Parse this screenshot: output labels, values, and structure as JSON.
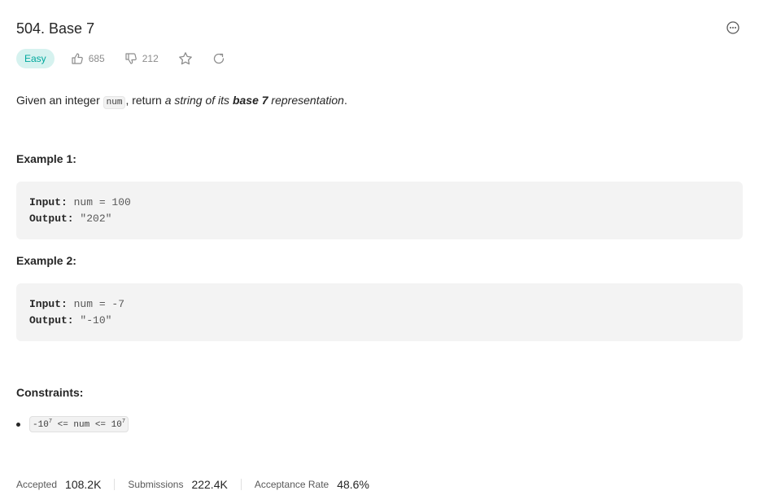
{
  "problem": {
    "title": "504. Base 7",
    "difficulty": "Easy",
    "likes": "685",
    "dislikes": "212"
  },
  "description": {
    "prefix": "Given an integer ",
    "code": "num",
    "middle": ", return ",
    "italic1": "a string of its ",
    "bold": "base 7",
    "italic2": " representation",
    "suffix": "."
  },
  "examples": [
    {
      "title": "Example 1:",
      "input_label": "Input:",
      "input_value": " num = 100",
      "output_label": "Output:",
      "output_value": " \"202\""
    },
    {
      "title": "Example 2:",
      "input_label": "Input:",
      "input_value": " num = -7",
      "output_label": "Output:",
      "output_value": " \"-10\""
    }
  ],
  "constraints": {
    "title": "Constraints:",
    "item_pre": "-10",
    "exp1": "7",
    "item_mid": " <= num <= 10",
    "exp2": "7"
  },
  "stats": {
    "accepted_label": "Accepted",
    "accepted_value": "108.2K",
    "submissions_label": "Submissions",
    "submissions_value": "222.4K",
    "rate_label": "Acceptance Rate",
    "rate_value": "48.6%"
  },
  "icons": {
    "like": "thumbs-up-icon",
    "dislike": "thumbs-down-icon",
    "star": "star-icon",
    "share": "share-icon",
    "more": "more-icon"
  },
  "colors": {
    "easy_bg": "#d6f2ef",
    "easy_text": "#00a89d",
    "code_block_bg": "#f3f3f3"
  }
}
